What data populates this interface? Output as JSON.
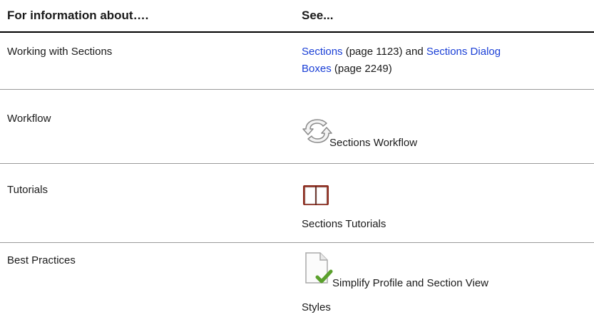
{
  "header": {
    "col1": "For information about….",
    "col2": "See..."
  },
  "rows": [
    {
      "topic": "Working with Sections",
      "link1": "Sections",
      "ref1": " (page 1123) and ",
      "link2_line1": "Sections Dialog",
      "link2_line2": "Boxes",
      "ref2": " (page 2249)"
    },
    {
      "topic": "Workflow",
      "icon": "workflow-cycle-icon",
      "label": "Sections Workflow"
    },
    {
      "topic": "Tutorials",
      "icon": "open-book-icon",
      "label": "Sections Tutorials"
    },
    {
      "topic": "Best Practices",
      "icon": "document-checkmark-icon",
      "label_line1": "Simplify Profile and Section View",
      "label_line2": "Styles"
    }
  ],
  "colors": {
    "link": "#1a3fd6",
    "book": "#8b2a1c",
    "check": "#5aa02c"
  }
}
